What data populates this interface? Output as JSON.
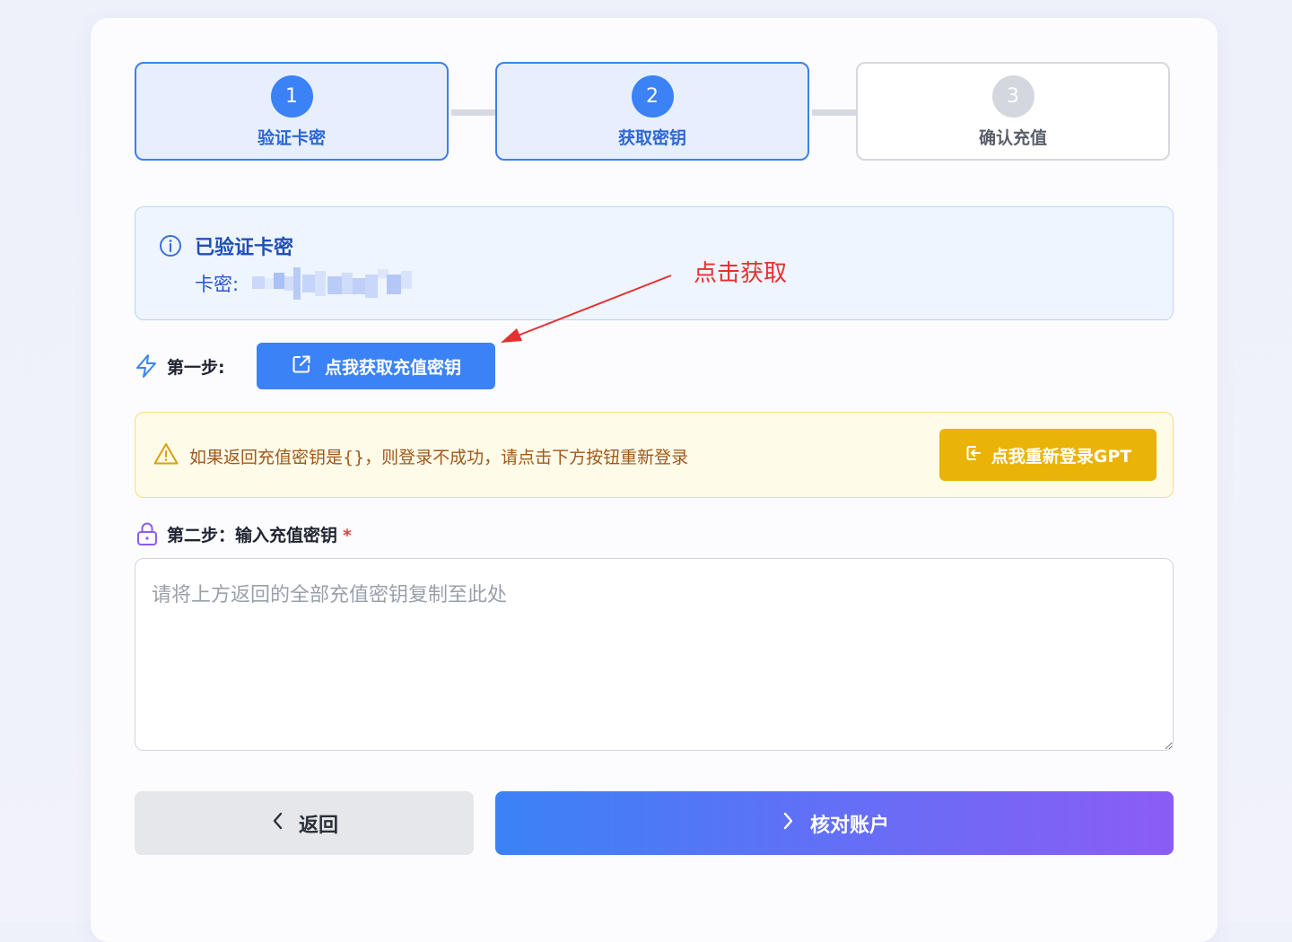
{
  "steps": [
    {
      "number": "1",
      "label": "验证卡密",
      "state": "active"
    },
    {
      "number": "2",
      "label": "获取密钥",
      "state": "active"
    },
    {
      "number": "3",
      "label": "确认充值",
      "state": "inactive"
    }
  ],
  "info": {
    "title": "已验证卡密",
    "key_label": "卡密:"
  },
  "annotation": {
    "text": "点击获取",
    "color": "#e53030"
  },
  "step_one": {
    "label": "第一步:",
    "button_label": "点我获取充值密钥"
  },
  "warning": {
    "text": "如果返回充值密钥是{}，则登录不成功，请点击下方按钮重新登录",
    "button_label": "点我重新登录GPT"
  },
  "step_two": {
    "label": "第二步：输入充值密钥",
    "required_mark": "*",
    "input_value": "",
    "input_placeholder": "请将上方返回的全部充值密钥复制至此处"
  },
  "actions": {
    "back_label": "返回",
    "verify_label": "核对账户"
  },
  "colors": {
    "primary": "#3b82f6",
    "warning_button": "#eab308",
    "gradient_end": "#8b5cf6"
  }
}
